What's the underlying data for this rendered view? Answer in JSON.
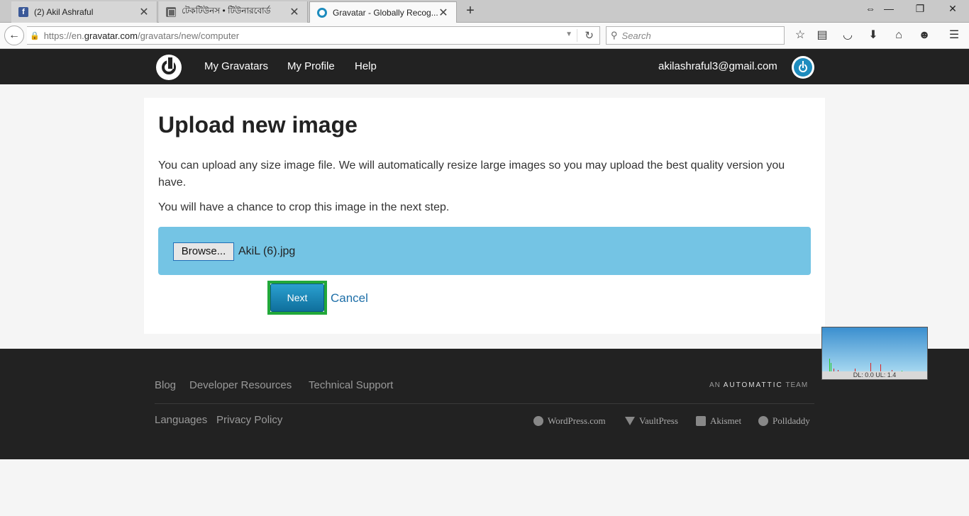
{
  "browser": {
    "tabs": [
      {
        "title": "(2) Akil Ashraful",
        "icon": "facebook-icon"
      },
      {
        "title": "টেকটিউনস • টিউনারবোর্ড",
        "icon": "techtunes-icon"
      },
      {
        "title": "Gravatar - Globally Recog...",
        "icon": "gravatar-icon"
      }
    ],
    "url_prefix": "https://en.",
    "url_domain": "gravatar.com",
    "url_path": "/gravatars/new/computer",
    "search_placeholder": "Search"
  },
  "header": {
    "nav": [
      "My Gravatars",
      "My Profile",
      "Help"
    ],
    "email": "akilashraful3@gmail.com"
  },
  "main": {
    "title": "Upload new image",
    "paragraph1": "You can upload any size image file. We will automatically resize large images so you may upload the best quality version you have.",
    "paragraph2": "You will have a chance to crop this image in the next step.",
    "browse_label": "Browse...",
    "filename": "AkiL (6).jpg",
    "next_label": "Next",
    "cancel_label": "Cancel"
  },
  "footer": {
    "links_row1": [
      "Blog",
      "Developer Resources",
      "Technical Support"
    ],
    "links_row2": [
      "Languages",
      "Privacy Policy"
    ],
    "automattic_prefix": "AN",
    "automattic_name": "AUTOMATTIC",
    "automattic_suffix": "TEAM",
    "brands": [
      "WordPress.com",
      "VaultPress",
      "Akismet",
      "Polldaddy"
    ]
  },
  "net_meter": {
    "label": "DL: 0.0 UL: 1.4"
  },
  "colors": {
    "header_bg": "#222222",
    "upload_box": "#74c4e4",
    "next_highlight": "#22a83a",
    "link": "#1e6fa8"
  }
}
